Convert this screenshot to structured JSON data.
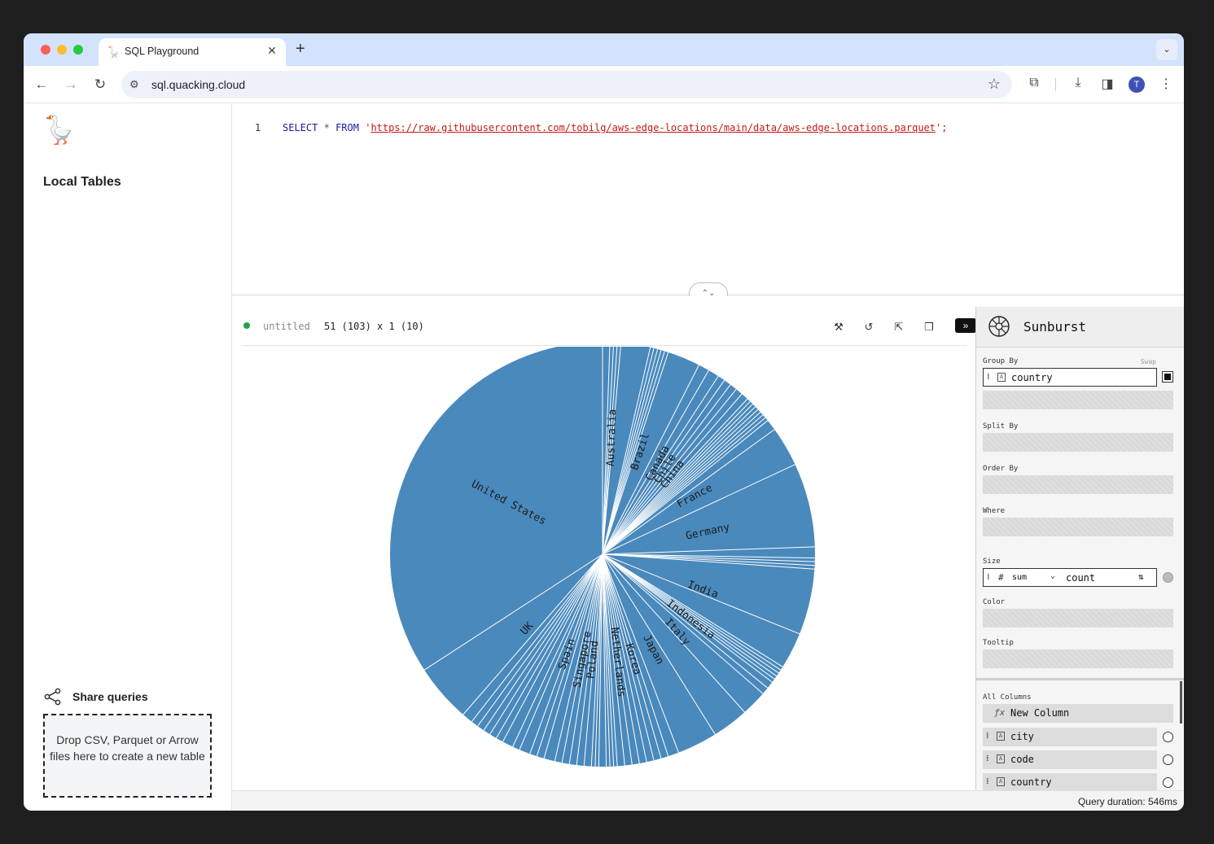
{
  "browser": {
    "tab_title": "SQL Playground",
    "tab_favicon": "🪿",
    "url": "sql.quacking.cloud",
    "avatar_letter": "T"
  },
  "sidebar": {
    "logo": "🪿",
    "section_title": "Local Tables",
    "share_label": "Share queries",
    "dropzone_text": "Drop CSV, Parquet or Arrow files here to create a new table"
  },
  "editor": {
    "line_number": "1",
    "kw_select": "SELECT",
    "star": "*",
    "kw_from": "FROM",
    "quote_open": "'",
    "url": "https://raw.githubusercontent.com/tobilg/aws-edge-locations/main/data/aws-edge-locations.parquet",
    "quote_close": "';"
  },
  "results": {
    "name": "untitled",
    "dims": "51 (103) x 1 (10)"
  },
  "config": {
    "plugin": "Sunburst",
    "group_by_label": "Group By",
    "swap_label": "Swap",
    "group_by_value": "country",
    "split_by_label": "Split By",
    "order_by_label": "Order By",
    "where_label": "Where",
    "size_label": "Size",
    "size_aggregate": "sum",
    "size_column": "count",
    "color_label": "Color",
    "tooltip_label": "Tooltip",
    "all_columns_label": "All Columns",
    "new_column_label": "New Column",
    "columns": [
      "city",
      "code",
      "country"
    ]
  },
  "footer": {
    "query_duration": "Query duration: 546ms"
  },
  "chart_data": {
    "type": "sunburst",
    "group_by": "country",
    "size": "sum of count",
    "fill_color": "#4a89bc",
    "labels": [
      "United States",
      "Australia",
      "Brazil",
      "Canada",
      "Chile",
      "China",
      "France",
      "Germany",
      "India",
      "Indonesia",
      "Italy",
      "Japan",
      "Korea",
      "Netherlands",
      "Poland",
      "Singapore",
      "Spain",
      "UK"
    ]
  }
}
